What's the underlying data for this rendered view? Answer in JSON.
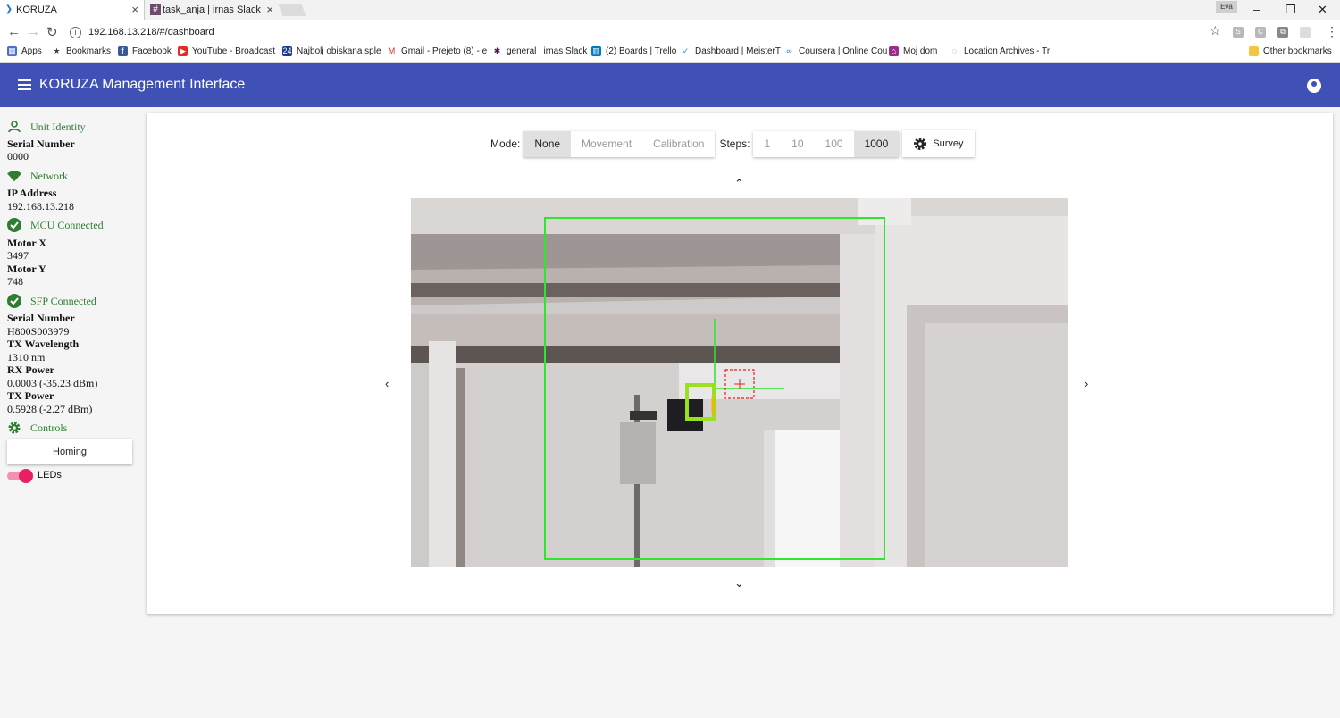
{
  "browser": {
    "tabs": [
      {
        "title": "KORUZA",
        "active": true
      },
      {
        "title": "task_anja | irnas Slack",
        "active": false
      }
    ],
    "profile_label": "Eva",
    "url": "192.168.13.218/#/dashboard",
    "bookmarks": [
      {
        "label": "Apps",
        "icon": "apps-grid-icon"
      },
      {
        "label": "Bookmarks",
        "icon": "star-icon"
      },
      {
        "label": "Facebook",
        "icon": "facebook-icon"
      },
      {
        "label": "YouTube - Broadcast",
        "icon": "youtube-icon"
      },
      {
        "label": "Najbolj obiskana sple",
        "icon": "24ur-icon"
      },
      {
        "label": "Gmail - Prejeto (8) - e",
        "icon": "gmail-icon"
      },
      {
        "label": "general | irnas Slack",
        "icon": "slack-icon"
      },
      {
        "label": "(2) Boards | Trello",
        "icon": "trello-icon"
      },
      {
        "label": "Dashboard | MeisterT",
        "icon": "meistertask-icon"
      },
      {
        "label": "Coursera | Online Cou",
        "icon": "coursera-icon"
      },
      {
        "label": "Moj dom",
        "icon": "moj-dom-icon"
      },
      {
        "label": "Location Archives - Tr",
        "icon": "location-icon"
      }
    ],
    "other_bookmarks": "Other bookmarks"
  },
  "app": {
    "title": "KORUZA Management Interface",
    "accent": "#3f51b5"
  },
  "sidebar": {
    "unit_identity": "Unit Identity",
    "serial_label": "Serial Number",
    "serial_value": "0000",
    "network": "Network",
    "ip_label": "IP Address",
    "ip_value": "192.168.13.218",
    "mcu": "MCU Connected",
    "motor_x_label": "Motor X",
    "motor_x_value": "3497",
    "motor_y_label": "Motor Y",
    "motor_y_value": "748",
    "sfp": "SFP Connected",
    "sfp_serial_label": "Serial Number",
    "sfp_serial_value": "H800S003979",
    "tx_wavelength_label": "TX Wavelength",
    "tx_wavelength_value": "1310 nm",
    "rx_power_label": "RX Power",
    "rx_power_value": "0.0003 (-35.23 dBm)",
    "tx_power_label": "TX Power",
    "tx_power_value": "0.5928 (-2.27 dBm)",
    "controls": "Controls",
    "homing": "Homing",
    "leds_label": "LEDs",
    "leds_on": true,
    "status_color": "#2e7d32"
  },
  "main": {
    "mode_label": "Mode:",
    "modes": [
      "None",
      "Movement",
      "Calibration"
    ],
    "selected_mode": "None",
    "steps_label": "Steps:",
    "steps": [
      "1",
      "10",
      "100",
      "1000"
    ],
    "selected_step": "1000",
    "survey": "Survey"
  }
}
